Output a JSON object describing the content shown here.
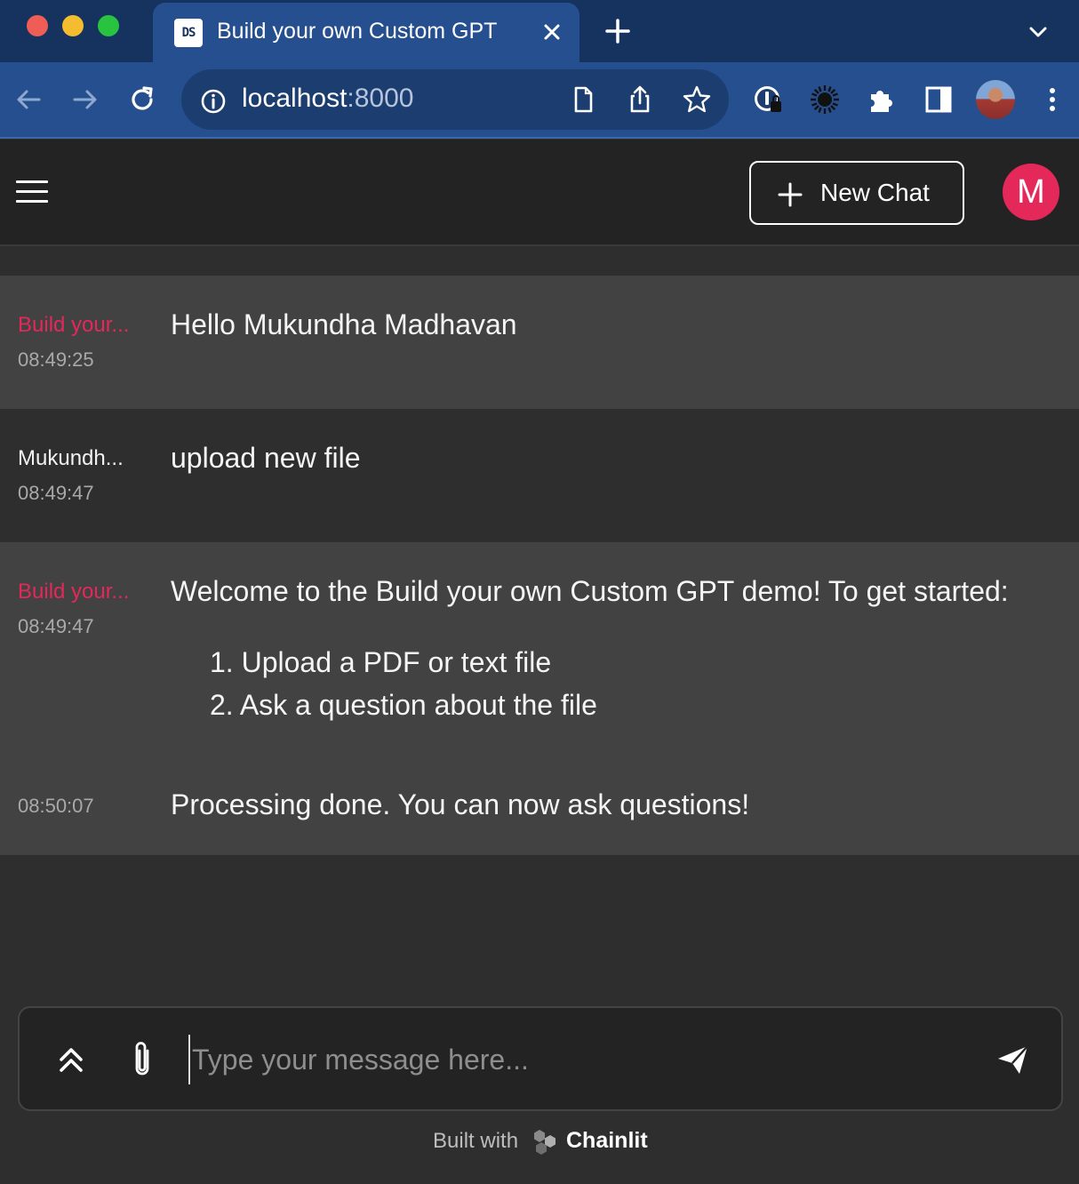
{
  "browser": {
    "tab": {
      "favicon_text": "DS",
      "title": "Build your own Custom GPT"
    },
    "url": {
      "host": "localhost",
      "port": ":8000"
    }
  },
  "header": {
    "new_chat_label": "New Chat",
    "avatar_initial": "M"
  },
  "messages": [
    {
      "author": "Build your...",
      "author_type": "bot",
      "time": "08:49:25",
      "content": "Hello Mukundha Madhavan"
    },
    {
      "author": "Mukundh...",
      "author_type": "user",
      "time": "08:49:47",
      "content": "upload new file"
    },
    {
      "author": "Build your...",
      "author_type": "bot",
      "time": "08:49:47",
      "content": "Welcome to the Build your own Custom GPT demo! To get started:",
      "list": [
        "1. Upload a PDF or text file",
        "2. Ask a question about the file"
      ]
    },
    {
      "author": "",
      "author_type": "bot",
      "time": "08:50:07",
      "content": "Processing done. You can now ask questions!"
    }
  ],
  "composer": {
    "placeholder": "Type your message here...",
    "value": ""
  },
  "footer": {
    "built_with": "Built with",
    "brand": "Chainlit"
  },
  "colors": {
    "accent": "#e4285a",
    "chrome_tabbar": "#16335f",
    "chrome_toolbar": "#254f8e",
    "app_background": "#2e2e2e",
    "message_alt_background": "#424242"
  }
}
